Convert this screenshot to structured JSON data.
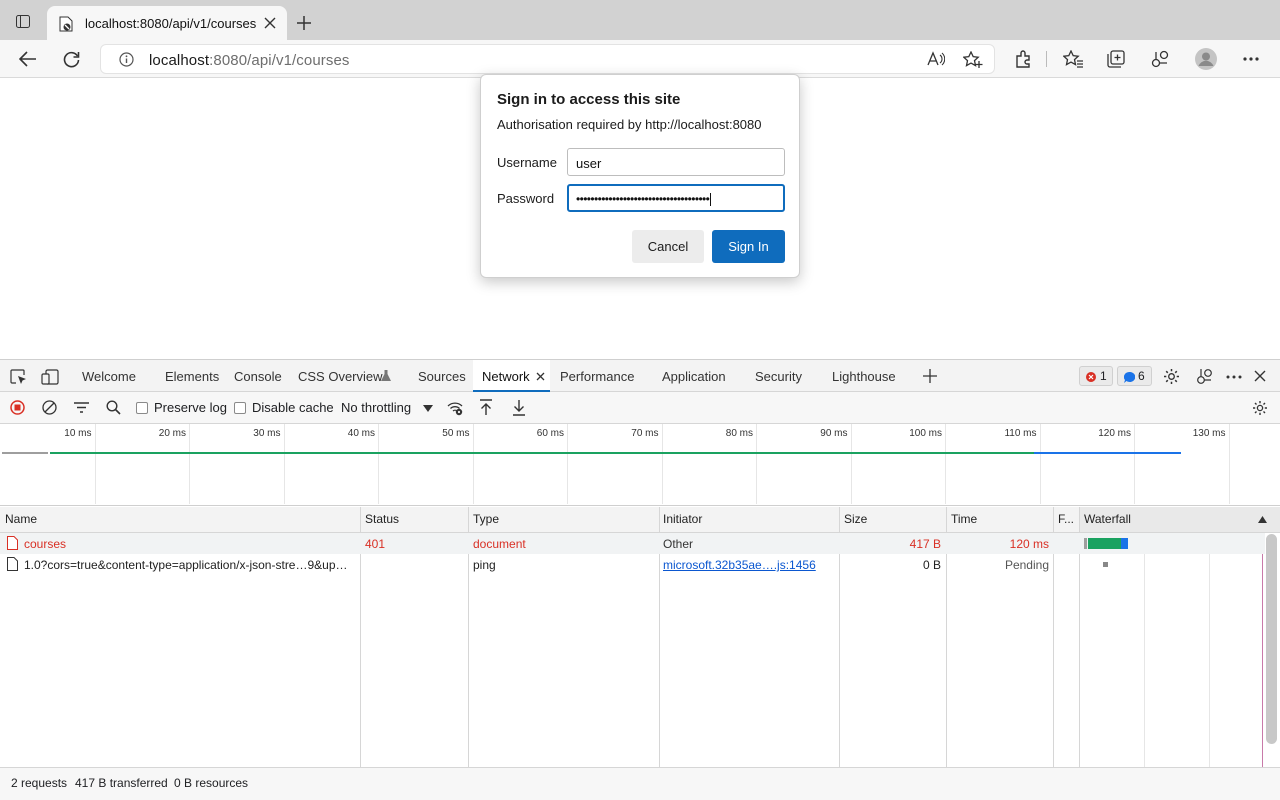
{
  "browser": {
    "tab_title": "localhost:8080/api/v1/courses",
    "url_host": "localhost",
    "url_rest": ":8080/api/v1/courses"
  },
  "dialog": {
    "title": "Sign in to access this site",
    "subtitle": "Authorisation required by http://localhost:8080",
    "username_label": "Username",
    "username_value": "user",
    "password_label": "Password",
    "password_value": "•••••••••••••••••••••••••••••••••••••",
    "cancel_label": "Cancel",
    "signin_label": "Sign In"
  },
  "devtools": {
    "tabs": [
      "Welcome",
      "Elements",
      "Console",
      "CSS Overview",
      "Sources",
      "Network",
      "Performance",
      "Application",
      "Security",
      "Lighthouse"
    ],
    "error_count": "1",
    "info_count": "6",
    "preserve_log_label": "Preserve log",
    "disable_cache_label": "Disable cache",
    "throttling_value": "No throttling",
    "timeline_ticks": [
      "10 ms",
      "20 ms",
      "30 ms",
      "40 ms",
      "50 ms",
      "60 ms",
      "70 ms",
      "80 ms",
      "90 ms",
      "100 ms",
      "110 ms",
      "120 ms",
      "130 ms"
    ],
    "columns": [
      "Name",
      "Status",
      "Type",
      "Initiator",
      "Size",
      "Time",
      "F...",
      "Waterfall"
    ],
    "rows": [
      {
        "name": "courses",
        "status": "401",
        "type": "document",
        "initiator": "Other",
        "size": "417 B",
        "time": "120 ms"
      },
      {
        "name": "1.0?cors=true&content-type=application/x-json-stre…9&up…",
        "status": "",
        "type": "ping",
        "initiator": "microsoft.32b35ae….js:1456",
        "size": "0 B",
        "time": "Pending"
      }
    ],
    "status_requests": "2 requests",
    "status_transferred": "417 B transferred",
    "status_resources": "0 B resources"
  },
  "colors": {
    "accent": "#0f6cbd",
    "error": "#d93025",
    "waterfall_green": "#1aa260",
    "waterfall_blue": "#1a73e8"
  }
}
